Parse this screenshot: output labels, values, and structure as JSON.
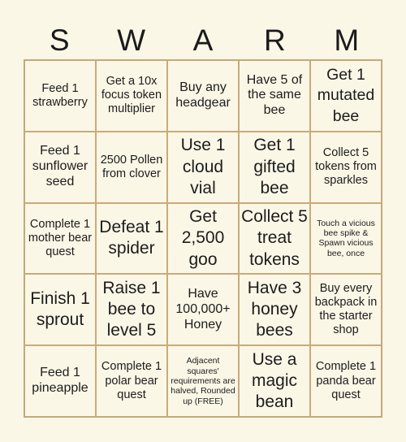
{
  "title_letters": [
    "S",
    "W",
    "A",
    "R",
    "M"
  ],
  "cells": [
    [
      "Feed 1 strawberry",
      "Get a 10x focus token multiplier",
      "Buy any headgear",
      "Have 5 of the same bee",
      "Get 1 mutated bee"
    ],
    [
      "Feed 1 sunflower seed",
      "2500 Pollen from clover",
      "Use 1 cloud vial",
      "Get 1 gifted bee",
      "Collect 5 tokens from sparkles"
    ],
    [
      "Complete 1 mother bear quest",
      "Defeat 1 spider",
      "Get 2,500 goo",
      "Collect 5 treat tokens",
      "Touch a vicious bee spike & Spawn vicious bee, once"
    ],
    [
      "Finish 1 sprout",
      "Raise 1 bee to level 5",
      "Have 100,000+ Honey",
      "Have 3 honey bees",
      "Buy every backpack in the starter shop"
    ],
    [
      "Feed 1 pineapple",
      "Complete 1 polar bear quest",
      "Adjacent squares' requirements are halved, Rounded up (FREE)",
      "Use a magic bean",
      "Complete 1 panda bear quest"
    ]
  ],
  "colors": {
    "background": "#FBF7E7",
    "border": "#C9AA7A",
    "text": "#1c1c1c"
  }
}
